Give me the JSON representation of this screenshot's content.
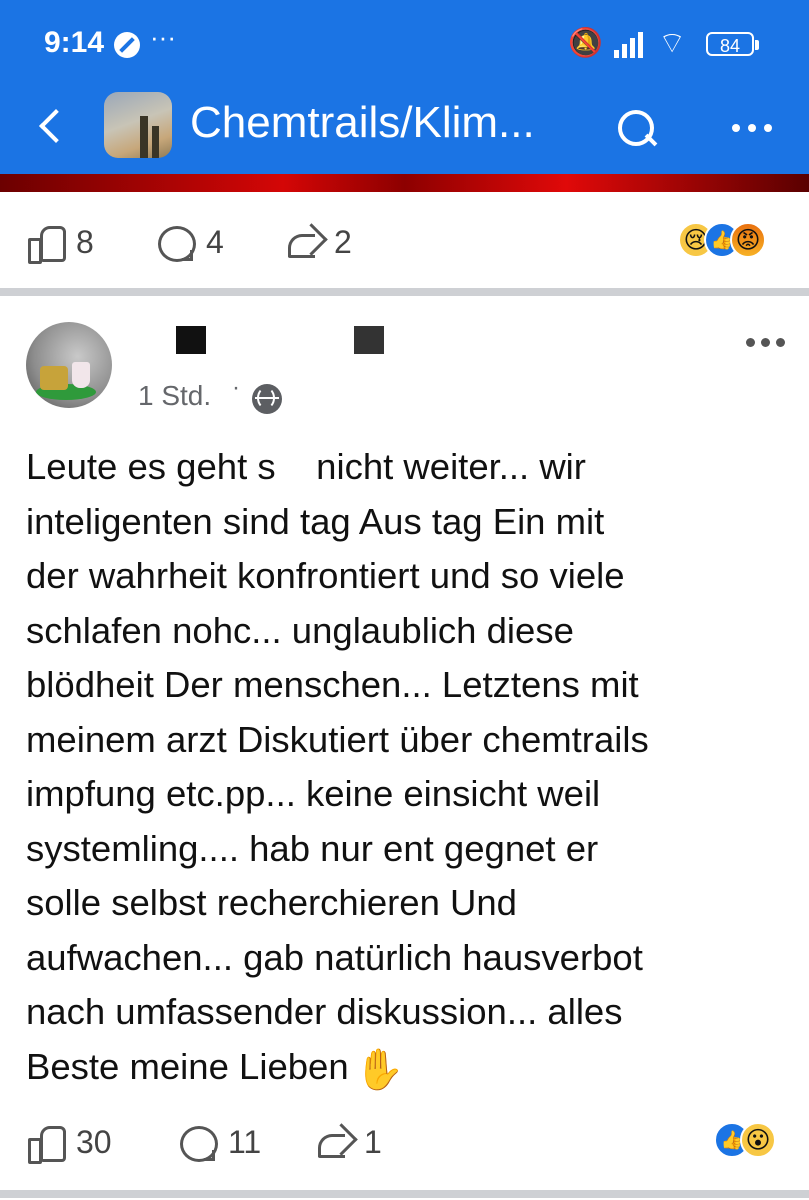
{
  "status_bar": {
    "time": "9:14",
    "dots": "···",
    "battery": "84"
  },
  "header": {
    "group_title": "Chemtrails/Klim...",
    "back_icon": "chevron-left-icon",
    "search_icon": "search-icon",
    "more_icon": "more-horizontal-icon"
  },
  "post1": {
    "likes": "8",
    "comments": "4",
    "shares": "2",
    "reactions": [
      "sad",
      "like",
      "angry"
    ]
  },
  "post2": {
    "time": "1 Std.",
    "dot": "·",
    "audience_icon": "globe-icon",
    "text_lines": [
      "Leute es geht s    nicht weiter... wir",
      "inteligenten sind tag Aus tag Ein mit",
      "der wahrheit konfrontiert und so viele",
      "schlafen nohc... unglaublich diese",
      "blödheit Der menschen... Letztens mit",
      "meinem arzt Diskutiert über chemtrails",
      "impfung etc.pp... keine einsicht weil",
      "systemling.... hab nur ent gegnet er",
      "solle selbst recherchieren Und",
      "aufwachen... gab natürlich hausverbot",
      "nach umfassender diskussion... alles",
      "Beste meine Lieben"
    ],
    "emoji_end": "✋",
    "likes": "30",
    "comments": "11",
    "shares": "1",
    "reactions": [
      "like",
      "wow"
    ]
  },
  "colors": {
    "header_blue": "#1b74e4",
    "divider_gray": "#ced0d4",
    "text_gray": "#65676b"
  }
}
